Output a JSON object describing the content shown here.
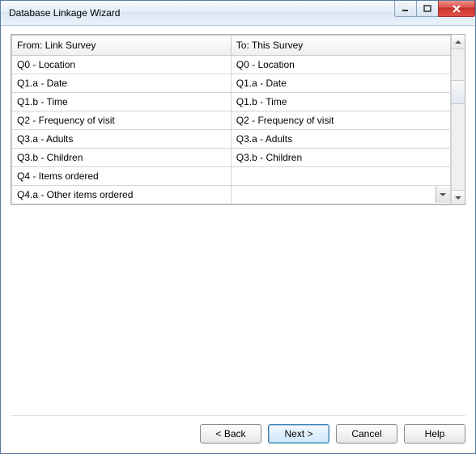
{
  "window": {
    "title": "Database Linkage Wizard"
  },
  "table": {
    "headers": {
      "from": "From: Link Survey",
      "to": "To: This Survey"
    },
    "rows": [
      {
        "from": "Q0 - Location",
        "to": "Q0 - Location"
      },
      {
        "from": "Q1.a - Date",
        "to": "Q1.a - Date"
      },
      {
        "from": "Q1.b - Time",
        "to": "Q1.b - Time"
      },
      {
        "from": "Q2 - Frequency of visit",
        "to": "Q2 - Frequency of visit"
      },
      {
        "from": "Q3.a - Adults",
        "to": "Q3.a - Adults"
      },
      {
        "from": "Q3.b - Children",
        "to": "Q3.b - Children"
      },
      {
        "from": "Q4 - Items ordered",
        "to": ""
      },
      {
        "from": "Q4.a - Other items ordered",
        "to": ""
      }
    ]
  },
  "buttons": {
    "back": "< Back",
    "next": "Next >",
    "cancel": "Cancel",
    "help": "Help"
  }
}
